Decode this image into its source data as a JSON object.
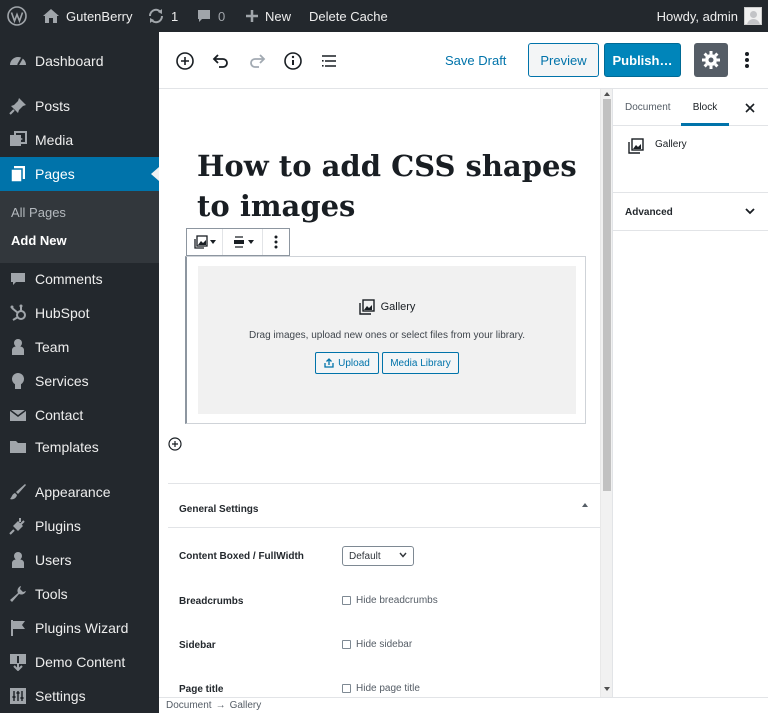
{
  "adminbar": {
    "site_name": "GutenBerry",
    "updates_count": "1",
    "comments_count": "0",
    "new_label": "New",
    "delete_cache_label": "Delete Cache",
    "howdy": "Howdy, admin"
  },
  "sidebar": {
    "items": [
      {
        "label": "Dashboard",
        "icon": "dashboard-icon"
      },
      {
        "label": "Posts",
        "icon": "pin-icon"
      },
      {
        "label": "Media",
        "icon": "media-icon"
      },
      {
        "label": "Pages",
        "icon": "pages-icon"
      },
      {
        "label": "Comments",
        "icon": "comment-icon"
      },
      {
        "label": "HubSpot",
        "icon": "hubspot-icon"
      },
      {
        "label": "Team",
        "icon": "person-icon"
      },
      {
        "label": "Services",
        "icon": "lightbulb-icon"
      },
      {
        "label": "Contact",
        "icon": "envelope-icon"
      },
      {
        "label": "Templates",
        "icon": "folder-icon"
      },
      {
        "label": "Appearance",
        "icon": "paintbrush-icon"
      },
      {
        "label": "Plugins",
        "icon": "plug-icon"
      },
      {
        "label": "Users",
        "icon": "users-icon"
      },
      {
        "label": "Tools",
        "icon": "wrench-icon"
      },
      {
        "label": "Plugins Wizard",
        "icon": "flag-icon"
      },
      {
        "label": "Demo Content",
        "icon": "download-icon"
      },
      {
        "label": "Settings",
        "icon": "settings-icon"
      }
    ],
    "submenu": {
      "all_pages": "All Pages",
      "add_new": "Add New"
    }
  },
  "toolbar": {
    "save_draft": "Save Draft",
    "preview": "Preview",
    "publish": "Publish…"
  },
  "editor": {
    "post_title": "How to add CSS shapes to images",
    "gallery": {
      "title": "Gallery",
      "instructions": "Drag images, upload new ones or select files from your library.",
      "upload_label": "Upload",
      "media_library_label": "Media Library"
    }
  },
  "meta": {
    "section_title": "General Settings",
    "content_label": "Content Boxed / FullWidth",
    "content_value": "Default",
    "breadcrumbs_label": "Breadcrumbs",
    "breadcrumbs_check": "Hide breadcrumbs",
    "sidebar_label": "Sidebar",
    "sidebar_check": "Hide sidebar",
    "page_title_label": "Page title",
    "page_title_check": "Hide page title"
  },
  "panel": {
    "tab_document": "Document",
    "tab_block": "Block",
    "block_name": "Gallery",
    "advanced_label": "Advanced"
  },
  "footer": {
    "crumb_root": "Document",
    "arrow": "→",
    "crumb_block": "Gallery"
  },
  "colors": {
    "admin_dark": "#23282d",
    "accent_blue": "#0073aa",
    "publish_blue": "#0085ba"
  }
}
